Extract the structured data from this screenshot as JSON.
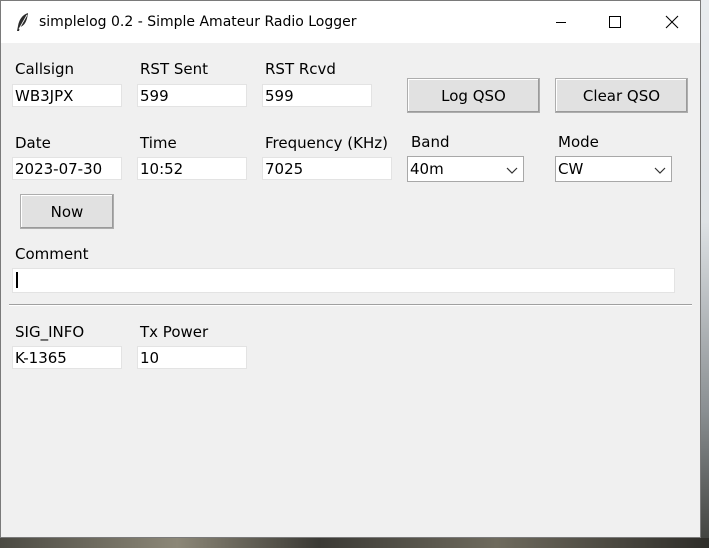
{
  "window": {
    "title": "simplelog 0.2 - Simple Amateur Radio Logger"
  },
  "controls": {
    "minimize": "minimize",
    "maximize": "maximize",
    "close": "close"
  },
  "labels": {
    "callsign": "Callsign",
    "rst_sent": "RST Sent",
    "rst_rcvd": "RST Rcvd",
    "date": "Date",
    "time": "Time",
    "frequency": "Frequency (KHz)",
    "band": "Band",
    "mode": "Mode",
    "comment": "Comment",
    "sig_info": "SIG_INFO",
    "tx_power": "Tx Power"
  },
  "fields": {
    "callsign": "WB3JPX",
    "rst_sent": "599",
    "rst_rcvd": "599",
    "date": "2023-07-30",
    "time": "10:52",
    "frequency": "7025",
    "band": "40m",
    "mode": "CW",
    "comment": "",
    "sig_info": "K-1365",
    "tx_power": "10"
  },
  "buttons": {
    "log_qso": "Log QSO",
    "clear_qso": "Clear QSO",
    "now": "Now"
  },
  "icons": {
    "app": "feather-icon",
    "dropdown": "chevron-down-icon"
  }
}
